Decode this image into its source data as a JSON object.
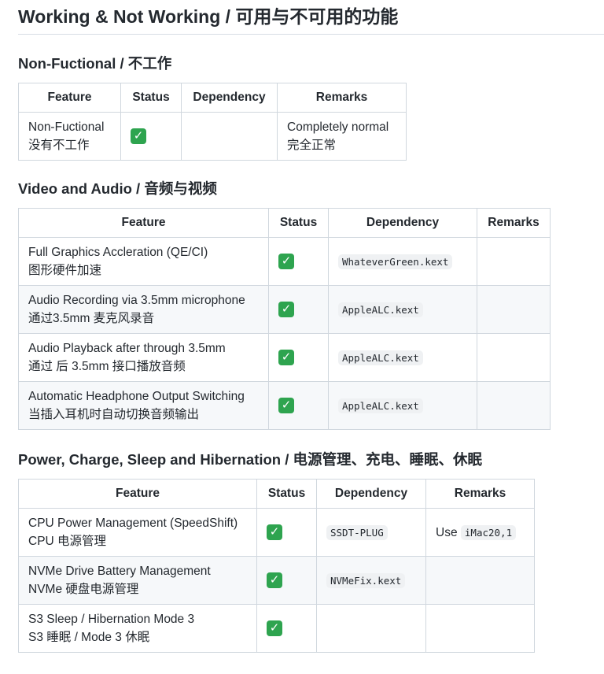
{
  "title": "Working & Not Working / 可用与不可用的功能",
  "check_symbol": "✓",
  "accent_color": "#2ea44f",
  "sections": [
    {
      "heading": "Non-Fuctional / 不工作",
      "headers": [
        "Feature",
        "Status",
        "Dependency",
        "Remarks"
      ],
      "rows": [
        {
          "feature_en": "Non-Fuctional",
          "feature_zh": "没有不工作",
          "status": "check",
          "dependency": "",
          "remarks_line1": "Completely normal",
          "remarks_line2": "完全正常"
        }
      ]
    },
    {
      "heading": "Video and Audio / 音频与视频",
      "headers": [
        "Feature",
        "Status",
        "Dependency",
        "Remarks"
      ],
      "rows": [
        {
          "feature_en": "Full Graphics Accleration (QE/CI)",
          "feature_zh": "图形硬件加速",
          "status": "check",
          "dependency": "WhateverGreen.kext",
          "remarks": ""
        },
        {
          "feature_en": "Audio Recording via 3.5mm microphone",
          "feature_zh": "通过3.5mm 麦克风录音",
          "status": "check",
          "dependency": "AppleALC.kext",
          "remarks": ""
        },
        {
          "feature_en": "Audio Playback after through 3.5mm",
          "feature_zh": "通过 后 3.5mm 接口播放音频",
          "status": "check",
          "dependency": "AppleALC.kext",
          "remarks": ""
        },
        {
          "feature_en": "Automatic Headphone Output Switching",
          "feature_zh": "当插入耳机时自动切换音频输出",
          "status": "check",
          "dependency": "AppleALC.kext",
          "remarks": ""
        }
      ]
    },
    {
      "heading": "Power, Charge, Sleep and Hibernation / 电源管理、充电、睡眠、休眠",
      "headers": [
        "Feature",
        "Status",
        "Dependency",
        "Remarks"
      ],
      "rows": [
        {
          "feature_en": "CPU Power Management (SpeedShift)",
          "feature_zh": "CPU 电源管理",
          "status": "check",
          "dependency": "SSDT-PLUG",
          "remarks_text": "Use",
          "remarks_code": "iMac20,1"
        },
        {
          "feature_en": "NVMe Drive Battery Management",
          "feature_zh": "NVMe 硬盘电源管理",
          "status": "check",
          "dependency": "NVMeFix.kext",
          "remarks": ""
        },
        {
          "feature_en": "S3 Sleep / Hibernation Mode 3",
          "feature_zh": "S3 睡眠 / Mode 3 休眠",
          "status": "check",
          "dependency": "",
          "remarks": ""
        }
      ]
    }
  ]
}
